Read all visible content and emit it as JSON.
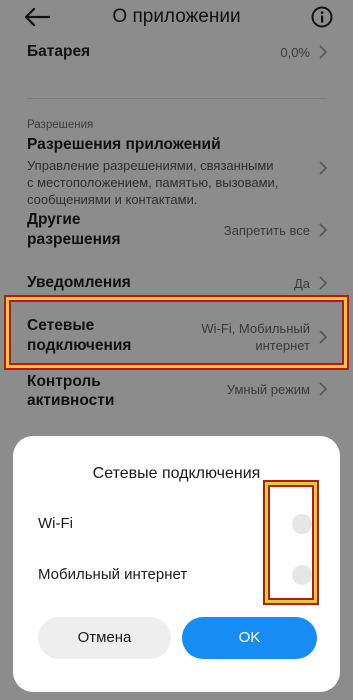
{
  "header": {
    "title": "О приложении",
    "back_icon": "arrow-left-icon",
    "info_icon": "info-icon"
  },
  "rows": {
    "battery": {
      "label": "Батарея",
      "value": "0,0%"
    },
    "section_label": "Разрешения",
    "app_permissions": {
      "label": "Разрешения приложений",
      "desc_lines": [
        "Управление разрешениями, связанными",
        "с местоположением, памятью, вызовами,",
        "сообщениями и контактами."
      ]
    },
    "other_permissions": {
      "label_lines": [
        "Другие",
        "разрешения"
      ],
      "value": "Запретить все"
    },
    "notifications": {
      "label": "Уведомления",
      "value": "Да"
    },
    "network": {
      "label_lines": [
        "Сетевые",
        "подключения"
      ],
      "value_lines": [
        "Wi-Fi, Мобильный",
        "интернет"
      ]
    },
    "activity": {
      "label_lines": [
        "Контроль",
        "активности"
      ],
      "value": "Умный режим"
    }
  },
  "dialog": {
    "title": "Сетевые подключения",
    "options": [
      {
        "label": "Wi-Fi",
        "checked": false
      },
      {
        "label": "Мобильный интернет",
        "checked": false
      }
    ],
    "cancel_label": "Отмена",
    "ok_label": "OK"
  },
  "colors": {
    "accent": "#168cf4",
    "highlight_outer": "#c0141a",
    "highlight_inner": "#d8d230",
    "dim_background": "#8c8c8c"
  }
}
